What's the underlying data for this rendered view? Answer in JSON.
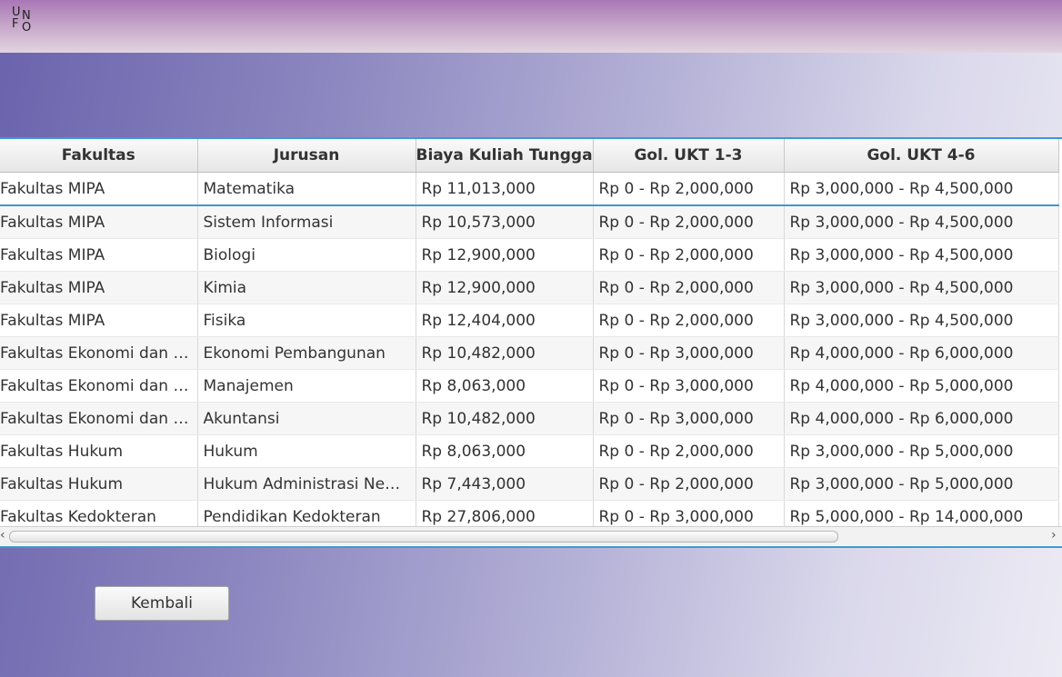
{
  "logo": {
    "letters": [
      "U",
      "N",
      "F",
      "O"
    ]
  },
  "table": {
    "headers": [
      "Fakultas",
      "Jurusan",
      "Biaya Kuliah Tunggal",
      "Gol. UKT 1-3",
      "Gol. UKT 4-6"
    ],
    "rows": [
      [
        "Fakultas MIPA",
        "Matematika",
        "Rp 11,013,000",
        "Rp 0 - Rp 2,000,000",
        "Rp 3,000,000 - Rp 4,500,000"
      ],
      [
        "Fakultas MIPA",
        "Sistem Informasi",
        "Rp 10,573,000",
        "Rp 0 - Rp 2,000,000",
        "Rp 3,000,000 - Rp 4,500,000"
      ],
      [
        "Fakultas MIPA",
        "Biologi",
        "Rp 12,900,000",
        "Rp 0 - Rp 2,000,000",
        "Rp 3,000,000 - Rp 4,500,000"
      ],
      [
        "Fakultas MIPA",
        "Kimia",
        "Rp 12,900,000",
        "Rp 0 - Rp 2,000,000",
        "Rp 3,000,000 - Rp 4,500,000"
      ],
      [
        "Fakultas MIPA",
        "Fisika",
        "Rp 12,404,000",
        "Rp 0 - Rp 2,000,000",
        "Rp 3,000,000 - Rp 4,500,000"
      ],
      [
        "Fakultas Ekonomi dan Bi...",
        "Ekonomi Pembangunan",
        "Rp 10,482,000",
        "Rp 0 - Rp 3,000,000",
        "Rp 4,000,000 - Rp 6,000,000"
      ],
      [
        "Fakultas Ekonomi dan Bi...",
        "Manajemen",
        "Rp 8,063,000",
        "Rp 0 - Rp 3,000,000",
        "Rp 4,000,000 - Rp 5,000,000"
      ],
      [
        "Fakultas Ekonomi dan Bi...",
        "Akuntansi",
        "Rp 10,482,000",
        "Rp 0 - Rp 3,000,000",
        "Rp 4,000,000 - Rp 6,000,000"
      ],
      [
        "Fakultas Hukum",
        "Hukum",
        "Rp 8,063,000",
        "Rp 0 - Rp 2,000,000",
        "Rp 3,000,000 - Rp 5,000,000"
      ],
      [
        "Fakultas Hukum",
        "Hukum Administrasi Negara",
        "Rp 7,443,000",
        "Rp 0 - Rp 2,000,000",
        "Rp 3,000,000 - Rp 5,000,000"
      ],
      [
        "Fakultas Kedokteran",
        "Pendidikan Kedokteran",
        "Rp 27,806,000",
        "Rp 0 - Rp 3,000,000",
        "Rp 5,000,000 - Rp 14,000,000"
      ]
    ]
  },
  "scrollbar": {
    "left_icon": "chevron-left-icon",
    "right_icon": "chevron-right-icon"
  },
  "buttons": {
    "back_label": "Kembali"
  },
  "colors": {
    "accent": "#3e9ad0",
    "header_top": "#a977b6",
    "background_start": "#6a63ad"
  }
}
